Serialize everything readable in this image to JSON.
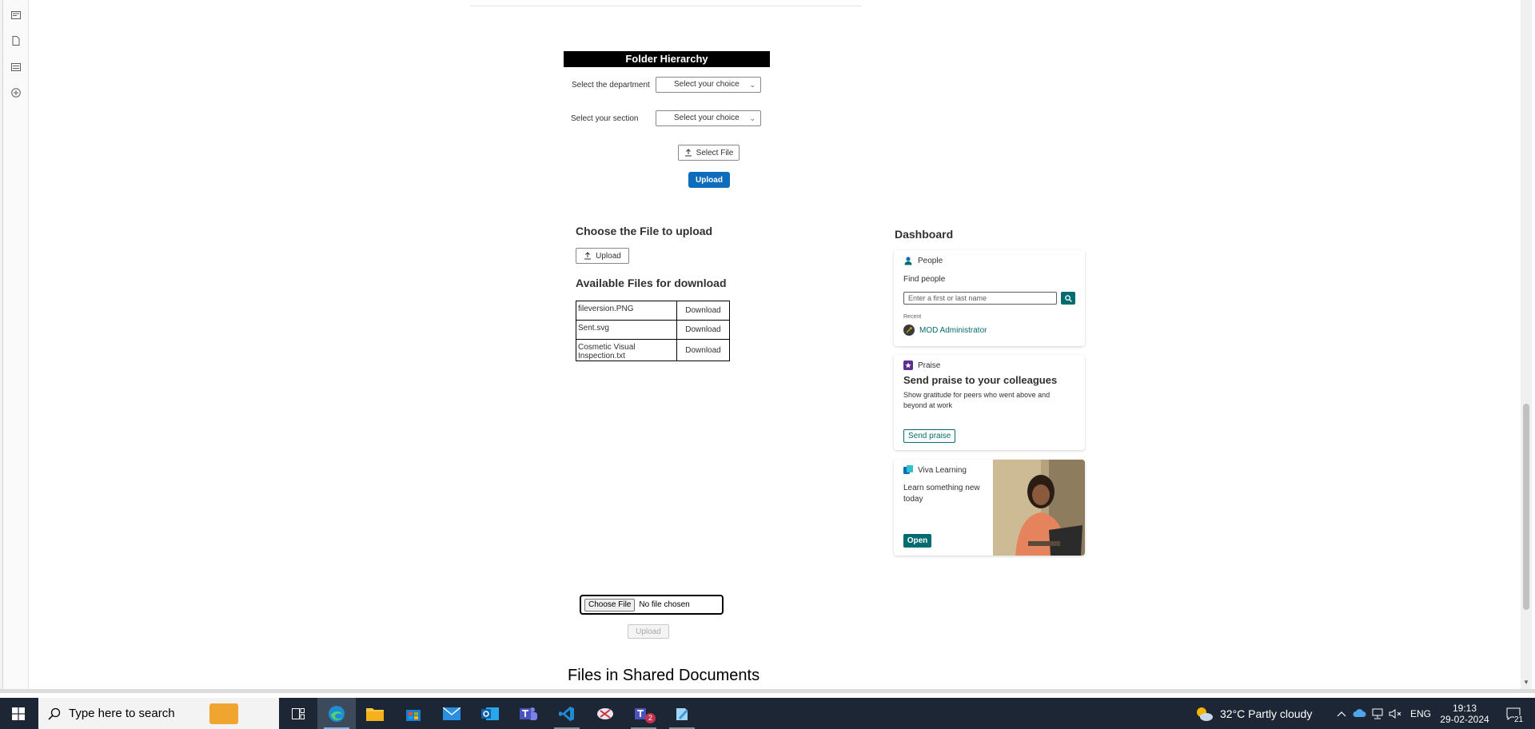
{
  "folder_hierarchy": {
    "title": "Folder Hierarchy",
    "department_label": "Select the department",
    "department_value": "Select your choice",
    "section_label": "Select your section",
    "section_value": "Select your choice",
    "select_file_label": "Select File",
    "upload_label": "Upload"
  },
  "file_upload": {
    "heading": "Choose the File to upload",
    "upload_label": "Upload"
  },
  "downloads": {
    "heading": "Available Files for download",
    "files": [
      {
        "name": "fileversion.PNG",
        "action": "Download"
      },
      {
        "name": "Sent.svg",
        "action": "Download"
      },
      {
        "name": "Cosmetic Visual Inspection.txt",
        "action": "Download"
      }
    ]
  },
  "dashboard": {
    "title": "Dashboard",
    "people": {
      "card_title": "People",
      "find_label": "Find people",
      "search_placeholder": "Enter a first or last name",
      "recent_label": "Recent",
      "recent_person": "MOD Administrator"
    },
    "praise": {
      "card_title": "Praise",
      "heading": "Send praise to your colleagues",
      "body": "Show gratitude for peers who went above and beyond at work",
      "button": "Send praise"
    },
    "viva": {
      "card_title": "Viva Learning",
      "body": "Learn something new today",
      "button": "Open"
    }
  },
  "native_upload": {
    "choose_label": "Choose File",
    "status": "No file chosen",
    "upload_label": "Upload"
  },
  "shared_documents": {
    "title": "Files in Shared Documents"
  },
  "taskbar": {
    "search_placeholder": "Type here to search",
    "teams_badge": "2",
    "weather": "32°C  Partly cloudy",
    "language": "ENG",
    "time": "19:13",
    "date": "29-02-2024",
    "notification_count": "21"
  },
  "colors": {
    "primary": "#0f6cbd",
    "teal": "#036c70",
    "taskbar": "#1d2634"
  }
}
